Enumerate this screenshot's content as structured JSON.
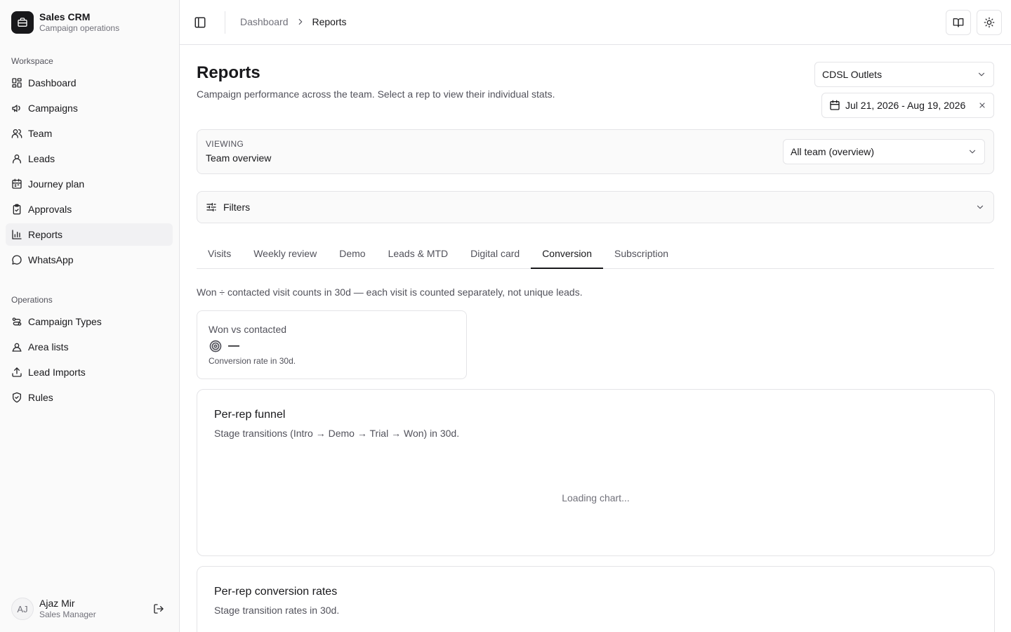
{
  "brand": {
    "name": "Sales CRM",
    "subtitle": "Campaign operations",
    "icon": "briefcase-icon"
  },
  "sidebar": {
    "groups": [
      {
        "label": "Workspace",
        "items": [
          {
            "label": "Dashboard",
            "icon": "layout-grid-icon"
          },
          {
            "label": "Campaigns",
            "icon": "megaphone-icon"
          },
          {
            "label": "Team",
            "icon": "users-icon"
          },
          {
            "label": "Leads",
            "icon": "user-icon"
          },
          {
            "label": "Journey plan",
            "icon": "calendar-icon"
          },
          {
            "label": "Approvals",
            "icon": "clipboard-check-icon"
          },
          {
            "label": "Reports",
            "icon": "bar-chart-icon",
            "active": true
          },
          {
            "label": "WhatsApp",
            "icon": "message-circle-icon"
          }
        ]
      },
      {
        "label": "Operations",
        "items": [
          {
            "label": "Campaign Types",
            "icon": "route-icon"
          },
          {
            "label": "Area lists",
            "icon": "user-square-icon"
          },
          {
            "label": "Lead Imports",
            "icon": "upload-icon"
          },
          {
            "label": "Rules",
            "icon": "shield-check-icon"
          }
        ]
      }
    ]
  },
  "user": {
    "initials": "AJ",
    "name": "Ajaz Mir",
    "role": "Sales Manager"
  },
  "header": {
    "breadcrumb": {
      "parent": "Dashboard",
      "current": "Reports"
    }
  },
  "page": {
    "title": "Reports",
    "subtitle": "Campaign performance across the team. Select a rep to view their individual stats.",
    "outlet_select": "CDSL Outlets",
    "date_range": "Jul 21, 2026 - Aug 19, 2026",
    "viewing_label": "VIEWING",
    "viewing_value": "Team overview",
    "viewing_select": "All team (overview)",
    "filters_label": "Filters",
    "tabs": [
      "Visits",
      "Weekly review",
      "Demo",
      "Leads & MTD",
      "Digital card",
      "Conversion",
      "Subscription"
    ],
    "active_tab": "Conversion",
    "note": "Won ÷ contacted visit counts in 30d — each visit is counted separately, not unique leads.",
    "kpi": {
      "title": "Won vs contacted",
      "value": "—",
      "footnote": "Conversion rate in 30d."
    },
    "cards": [
      {
        "title": "Per-rep funnel",
        "subtitle": "Stage transitions (Intro → Demo → Trial → Won) in 30d.",
        "loading": "Loading chart..."
      },
      {
        "title": "Per-rep conversion rates",
        "subtitle": "Stage transition rates in 30d."
      }
    ]
  }
}
